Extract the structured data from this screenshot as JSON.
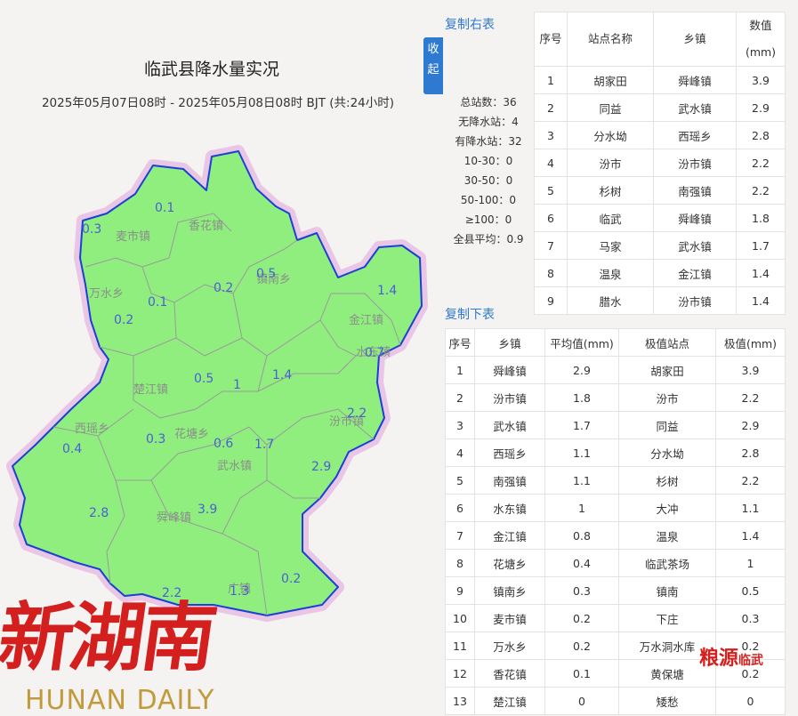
{
  "map": {
    "title": "临武县降水量实况",
    "subtitle": "2025年05月07日08时 - 2025年05月08日08时 BJT (共:24小时)",
    "fill_color": "#90ee7f",
    "border_color": "#1b3fd8",
    "region_labels": [
      "麦市镇",
      "香花镇",
      "镇南乡",
      "万水乡",
      "金江镇",
      "水东镇",
      "楚江镇",
      "汾市镇",
      "西瑶乡",
      "花塘乡",
      "武水镇",
      "舜峰镇",
      "广镇"
    ],
    "values": [
      "0.3",
      "0.1",
      "0.5",
      "0.2",
      "0.1",
      "0.2",
      "1.4",
      "0.7",
      "0.5",
      "1",
      "1.4",
      "2.2",
      "0.3",
      "0.6",
      "1.7",
      "0.4",
      "2.9",
      "2.8",
      "3.9",
      "2.2",
      "1.3",
      "0.2"
    ]
  },
  "toggle": {
    "chars": [
      "收",
      "起"
    ]
  },
  "stats": {
    "total": "总站数：36",
    "no_rain": "无降水站：4",
    "rain": "有降水站：32",
    "r10_30": "10-30：0",
    "r30_50": "30-50：0",
    "r50_100": "50-100：0",
    "r100": "≥100：0",
    "avg": "全县平均：0.9"
  },
  "copy_right": "复制右表",
  "copy_below": "复制下表",
  "stations_table": {
    "headers": [
      "序号",
      "站点名称",
      "乡镇",
      "数值(mm)"
    ],
    "rows": [
      [
        "1",
        "胡家田",
        "舜峰镇",
        "3.9"
      ],
      [
        "2",
        "同益",
        "武水镇",
        "2.9"
      ],
      [
        "3",
        "分水坳",
        "西瑶乡",
        "2.8"
      ],
      [
        "4",
        "汾市",
        "汾市镇",
        "2.2"
      ],
      [
        "5",
        "杉树",
        "南强镇",
        "2.2"
      ],
      [
        "6",
        "临武",
        "舜峰镇",
        "1.8"
      ],
      [
        "7",
        "马家",
        "武水镇",
        "1.7"
      ],
      [
        "8",
        "温泉",
        "金江镇",
        "1.4"
      ],
      [
        "9",
        "腊水",
        "汾市镇",
        "1.4"
      ]
    ]
  },
  "towns_table": {
    "headers": [
      "序号",
      "乡镇",
      "平均值(mm)",
      "极值站点",
      "极值(mm)"
    ],
    "rows": [
      [
        "1",
        "舜峰镇",
        "2.9",
        "胡家田",
        "3.9"
      ],
      [
        "2",
        "汾市镇",
        "1.8",
        "汾市",
        "2.2"
      ],
      [
        "3",
        "武水镇",
        "1.7",
        "同益",
        "2.9"
      ],
      [
        "4",
        "西瑶乡",
        "1.1",
        "分水坳",
        "2.8"
      ],
      [
        "5",
        "南强镇",
        "1.1",
        "杉树",
        "2.2"
      ],
      [
        "6",
        "水东镇",
        "1",
        "大冲",
        "1.1"
      ],
      [
        "7",
        "金江镇",
        "0.8",
        "温泉",
        "1.4"
      ],
      [
        "8",
        "花塘乡",
        "0.4",
        "临武茶场",
        "1"
      ],
      [
        "9",
        "镇南乡",
        "0.3",
        "镇南",
        "0.5"
      ],
      [
        "10",
        "麦市镇",
        "0.2",
        "下庄",
        "0.3"
      ],
      [
        "11",
        "万水乡",
        "0.2",
        "万水洞水库",
        "0.2"
      ],
      [
        "12",
        "香花镇",
        "0.1",
        "黄保塘",
        "0.2"
      ],
      [
        "13",
        "楚江镇",
        "0",
        "矮愁",
        "0"
      ]
    ]
  },
  "logo": {
    "main": "新湖南",
    "sub": "HUNAN DAILY"
  },
  "watermark": {
    "main": "临武",
    "pre": "粮源"
  }
}
